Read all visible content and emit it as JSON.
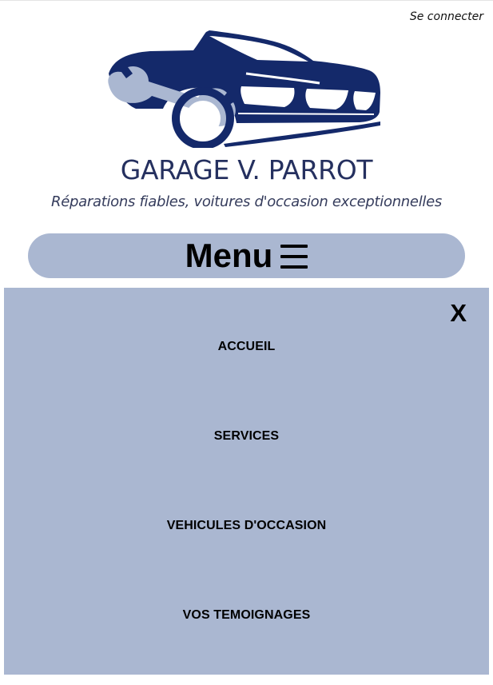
{
  "header": {
    "login_label": "Se connecter",
    "brand_name": "GARAGE V. PARROT",
    "tagline": "Réparations fiables, voitures d'occasion exceptionnelles"
  },
  "menu": {
    "toggle_label": "Menu",
    "toggle_icon": "hamburger-icon",
    "close_label": "X",
    "items": [
      {
        "label": "ACCUEIL"
      },
      {
        "label": "SERVICES"
      },
      {
        "label": "VEHICULES D'OCCASION"
      },
      {
        "label": "VOS TEMOIGNAGES"
      }
    ]
  },
  "colors": {
    "brand_navy": "#14296a",
    "wrench": "#aab7d1",
    "menu_bg": "#aab7d1"
  }
}
